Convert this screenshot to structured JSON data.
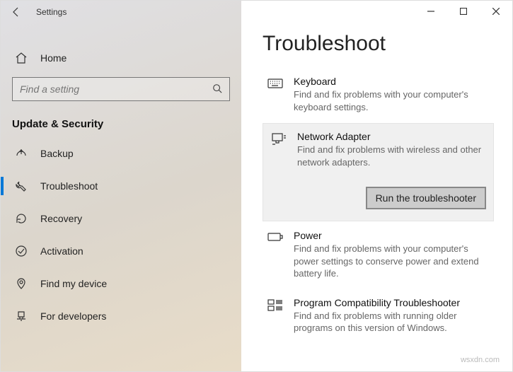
{
  "app": {
    "title": "Settings"
  },
  "sidebar": {
    "home_label": "Home",
    "search_placeholder": "Find a setting",
    "section_heading": "Update & Security",
    "items": [
      {
        "label": "Backup"
      },
      {
        "label": "Troubleshoot"
      },
      {
        "label": "Recovery"
      },
      {
        "label": "Activation"
      },
      {
        "label": "Find my device"
      },
      {
        "label": "For developers"
      }
    ]
  },
  "main": {
    "page_title": "Troubleshoot",
    "troubleshooters": [
      {
        "name": "Keyboard",
        "desc": "Find and fix problems with your computer's keyboard settings."
      },
      {
        "name": "Network Adapter",
        "desc": "Find and fix problems with wireless and other network adapters.",
        "selected": true,
        "run_label": "Run the troubleshooter"
      },
      {
        "name": "Power",
        "desc": "Find and fix problems with your computer's power settings to conserve power and extend battery life."
      },
      {
        "name": "Program Compatibility Troubleshooter",
        "desc": "Find and fix problems with running older programs on this version of Windows."
      }
    ]
  },
  "watermark": "wsxdn.com"
}
